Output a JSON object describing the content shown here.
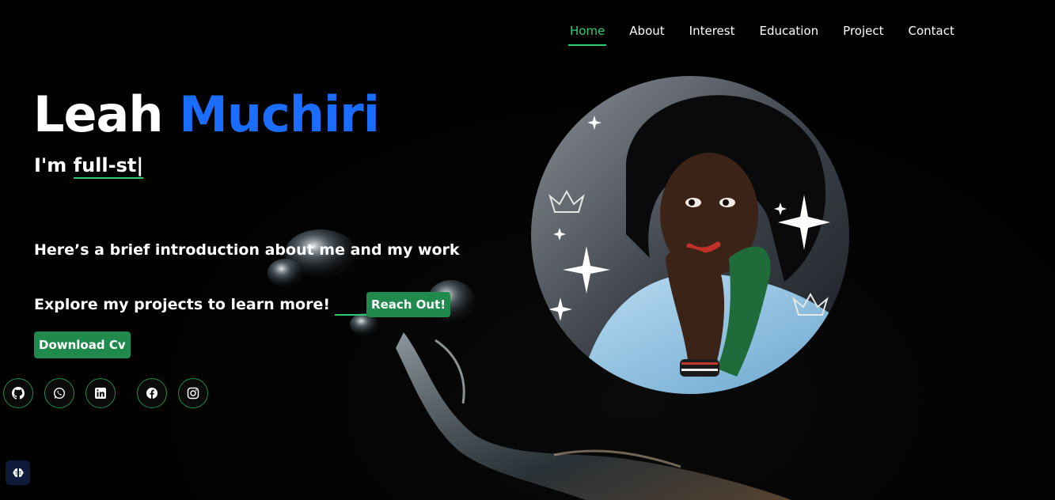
{
  "nav": {
    "items": [
      {
        "label": "Home",
        "active": true
      },
      {
        "label": "About",
        "active": false
      },
      {
        "label": "Interest",
        "active": false
      },
      {
        "label": "Education",
        "active": false
      },
      {
        "label": "Project",
        "active": false
      },
      {
        "label": "Contact",
        "active": false
      }
    ]
  },
  "hero": {
    "first_name": "Leah",
    "last_name": "Muchiri",
    "typed_prefix": "I'm",
    "typed_text": "full-st",
    "intro": "Here’s a brief introduction about me and my work",
    "explore": "Explore my projects to learn more!",
    "reach_button": "Reach Out!",
    "cv_button": "Download Cv"
  },
  "socials": [
    {
      "icon": "github-icon"
    },
    {
      "icon": "whatsapp-icon"
    },
    {
      "icon": "linkedin-icon"
    },
    {
      "icon": "facebook-icon"
    },
    {
      "icon": "instagram-icon"
    }
  ],
  "colors": {
    "accent_green": "#2ecc71",
    "button_green": "#1f8a4c",
    "name_blue": "#1a6dff",
    "background": "#000000"
  }
}
